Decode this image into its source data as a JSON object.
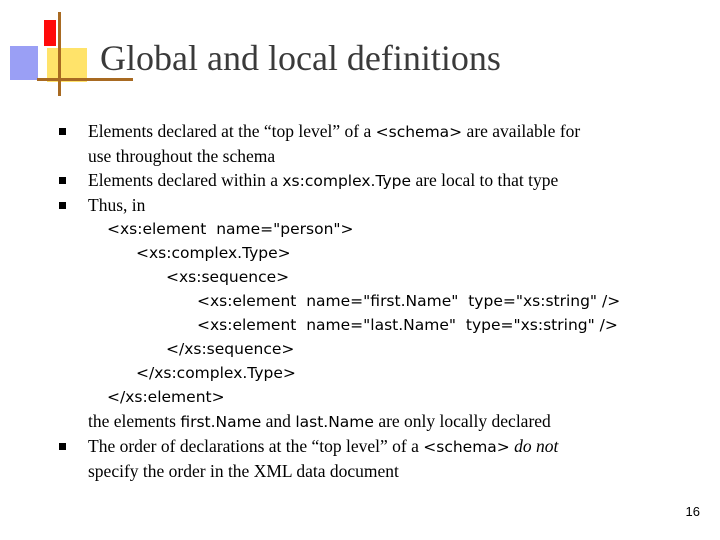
{
  "title": "Global and local definitions",
  "bullet1": {
    "a": "Elements declared at the “top level” of a ",
    "code": "<schema>",
    "b": " are available for",
    "line2": "use throughout the schema"
  },
  "bullet2": {
    "a": "Elements declared within a ",
    "code": "xs:complex.Type",
    "b": " are local to that type"
  },
  "bullet3": {
    "text": "Thus, in"
  },
  "code_lines": [
    "<xs:element  name=\"person\">",
    "<xs:complex.Type>",
    "<xs:sequence>",
    "<xs:element  name=\"first.Name\"  type=\"xs:string\" />",
    "<xs:element  name=\"last.Name\"  type=\"xs:string\" />",
    "</xs:sequence>",
    "</xs:complex.Type>",
    "</xs:element>"
  ],
  "conclusion": {
    "a": "the elements ",
    "code1": "first.Name",
    "b": " and ",
    "code2": "last.Name",
    "c": " are only locally declared"
  },
  "bullet4": {
    "a": "The order of declarations at the “top level” of a ",
    "code": "<schema>",
    "b": " ",
    "em": "do not",
    "line2": "specify the order in the XML data document"
  },
  "page_number": "16",
  "colors": {
    "title": "#3a3a3a",
    "deco_blue": "#9a9ff5",
    "deco_yellow": "#ffe36a",
    "deco_red": "#ff0a0a",
    "deco_line": "#a86a22"
  }
}
